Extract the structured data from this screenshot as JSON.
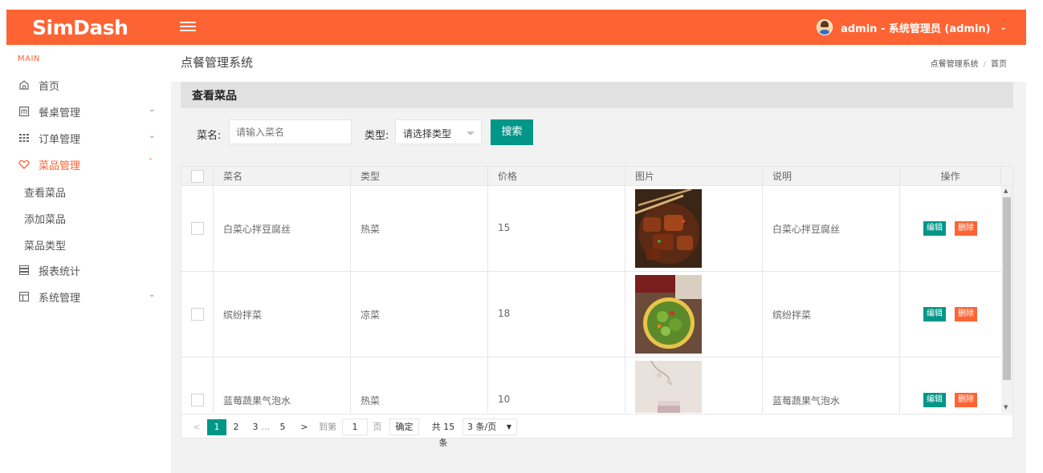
{
  "brand": {
    "logo_text": "SimDash"
  },
  "header": {
    "user_label": "admin - 系统管理员 (admin)",
    "colors": {
      "header_bg": "#fe6433",
      "primary": "#009688",
      "danger": "#fe6433"
    }
  },
  "sidebar": {
    "section_label": "MAIN",
    "items": [
      {
        "label": "首页",
        "icon": "home-icon"
      },
      {
        "label": "餐桌管理",
        "icon": "table-icon"
      },
      {
        "label": "订单管理",
        "icon": "grid-icon"
      },
      {
        "label": "菜品管理",
        "icon": "heart-icon",
        "active": true
      },
      {
        "label": "报表统计",
        "icon": "report-icon"
      },
      {
        "label": "系统管理",
        "icon": "layout-icon"
      }
    ],
    "sub_items": [
      {
        "label": "查看菜品"
      },
      {
        "label": "添加菜品"
      },
      {
        "label": "菜品类型"
      }
    ]
  },
  "page": {
    "title": "点餐管理系统",
    "breadcrumb": [
      "点餐管理系统",
      "首页"
    ],
    "card_title": "查看菜品"
  },
  "search": {
    "name_label": "菜名:",
    "name_placeholder": "请输入菜名",
    "type_label": "类型:",
    "type_selected": "请选择类型",
    "button_label": "搜索"
  },
  "table": {
    "columns": [
      "菜名",
      "类型",
      "价格",
      "图片",
      "说明",
      "操作"
    ],
    "rows": [
      {
        "name": "白菜心拌豆腐丝",
        "type": "热菜",
        "price": "15",
        "image": "braised-pork-photo",
        "desc": "白菜心拌豆腐丝"
      },
      {
        "name": "缤纷拌菜",
        "type": "凉菜",
        "price": "18",
        "image": "mixed-salad-photo",
        "desc": "缤纷拌菜"
      },
      {
        "name": "蓝莓蔬果气泡水",
        "type": "热菜",
        "price": "10",
        "image": "blueberry-drink-photo",
        "desc": "蓝莓蔬果气泡水"
      }
    ],
    "edit_label": "编辑",
    "delete_label": "删除"
  },
  "pagination": {
    "prev": "<",
    "pages": [
      "1",
      "2",
      "3",
      "…",
      "5"
    ],
    "current": "1",
    "next": ">",
    "goto_label": "到第",
    "goto_value": "1",
    "page_unit": "页",
    "confirm_label": "确定",
    "total_label": "共 15 条",
    "page_size": "3 条/页"
  }
}
